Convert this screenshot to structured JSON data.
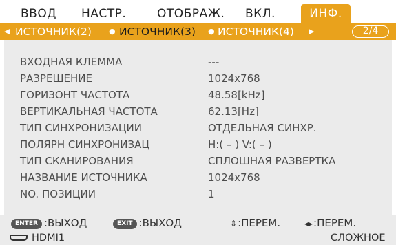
{
  "tabs": [
    {
      "label": "ВВОД"
    },
    {
      "label": "НАСТР."
    },
    {
      "label": "ОТОБРАЖ."
    },
    {
      "label": "ВКЛ."
    },
    {
      "label": "ИНФ."
    }
  ],
  "active_tab": "ИНФ.",
  "source_nav": {
    "left_arrow": "◀",
    "prev": "ИСТОЧНИК(2)",
    "sep1": "●",
    "current": "ИСТОЧНИК(3)",
    "sep2": "●",
    "next": "ИСТОЧНИК(4)",
    "right_arrow": "▶",
    "page": "2/4"
  },
  "info_rows": [
    {
      "label": "ВХОДНАЯ КЛЕММА",
      "value": "---"
    },
    {
      "label": "РАЗРЕШЕНИЕ",
      "value": "1024x768"
    },
    {
      "label": "ГОРИЗОНТ ЧАСТОТА",
      "value": "48.58[kHz]"
    },
    {
      "label": "ВЕРТИКАЛЬНАЯ ЧАСТОТА",
      "value": "62.13[Hz]"
    },
    {
      "label": "ТИП СИНХРОНИЗАЦИИ",
      "value": "ОТДЕЛЬНАЯ СИНХР."
    },
    {
      "label": "ПОЛЯРН СИНХРОНИЗАЦ",
      "value": "H:( – ) V:( – )"
    },
    {
      "label": "ТИП СКАНИРОВАНИЯ",
      "value": "СПЛОШНАЯ РАЗВЕРТКА"
    },
    {
      "label": "НАЗВАНИЕ ИСТОЧНИКА",
      "value": "1024x768"
    },
    {
      "label": "NO. ПОЗИЦИИ",
      "value": "1"
    }
  ],
  "footer": {
    "enter_key": "ENTER",
    "enter_action": ":ВЫХОД",
    "exit_key": "EXIT",
    "exit_action": ":ВЫХОД",
    "updown_symbol": "⇕",
    "updown_action": ":ПЕРЕМ.",
    "leftright_symbol": "◂▸",
    "leftright_action": ":ПЕРЕМ.",
    "input_name": "HDMI1",
    "mode": "СЛОЖНОЕ"
  },
  "colors": {
    "accent": "#e9a21c",
    "panel": "#ebebeb",
    "text": "#4d4d4d"
  }
}
